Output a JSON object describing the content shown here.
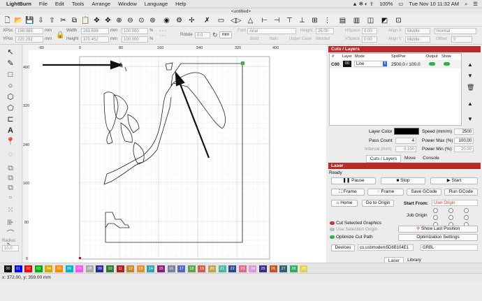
{
  "menubar": {
    "apple": "",
    "app": "LightBurn",
    "items": [
      "File",
      "Edit",
      "Tools",
      "Arrange",
      "Window",
      "Language",
      "Help"
    ],
    "battery": "100%",
    "clock": "Tue Nov 10  11:32 AM",
    "badge": "5"
  },
  "window": {
    "title": "<untitled>"
  },
  "props": {
    "xpos_label": "XPos",
    "xpos": "198.085",
    "ypos_label": "YPos",
    "ypos": "220.292",
    "width_label": "Width",
    "width": "283.598",
    "height_label": "Height",
    "height": "370.452",
    "unit": "mm",
    "wpct": "100.000",
    "hpct": "100.000",
    "pct": "%",
    "rotate_label": "Rotate",
    "rotate": "0.0",
    "mm_btn": "mm",
    "font_label": "Font",
    "font": "Arial",
    "theight_label": "Height",
    "theight": "25.00",
    "hspace_label": "HSpace",
    "hspace": "0.00",
    "aligny_label": "Align X",
    "alignx": "Middle",
    "normal": "Normal",
    "bold": "Bold",
    "italic": "Italic",
    "upper": "Upper Case",
    "welded": "Welded",
    "vspace_label": "VSpace",
    "vspace": "0.00",
    "aligny2_label": "Align Y",
    "aligny": "Middle",
    "offset_label": "Offset",
    "offset": "0"
  },
  "ruler": {
    "top": [
      "-80",
      "0",
      "80",
      "160",
      "240",
      "320",
      "400"
    ],
    "left": [
      "400",
      "320",
      "240",
      "160",
      "80",
      "0"
    ]
  },
  "lefttools": {
    "radius_label": "Radius:",
    "radius": "10.0"
  },
  "cuts": {
    "title": "Cuts / Layers",
    "cols": [
      "#",
      "Layer",
      "Mode",
      "Spd/Pwr",
      "Output",
      "Show"
    ],
    "row": {
      "num": "C00",
      "layer": "00",
      "mode": "Line",
      "spdpwr": "2500.0 / 100.0"
    },
    "layer_color_label": "Layer Color",
    "speed_label": "Speed (mm/m)",
    "speed": "2500",
    "pass_label": "Pass Count",
    "pass": "4",
    "pmax_label": "Power Max (%)",
    "pmax": "100.00",
    "interval_label": "Interval (mm)",
    "interval": "0.100",
    "pmin_label": "Power Min (%)",
    "pmin": "20.00",
    "tabs": [
      "Cuts / Layers",
      "Move",
      "Console"
    ]
  },
  "laser": {
    "title": "Laser",
    "status": "Ready",
    "pause": "Pause",
    "stop": "Stop",
    "start": "Start",
    "frame1": "Frame",
    "frame2": "Frame",
    "save_gcode": "Save GCode",
    "run_gcode": "Run GCode",
    "home": "Home",
    "goto_origin": "Go to Origin",
    "start_from_label": "Start From:",
    "start_from": "User Origin",
    "job_origin": "Job Origin",
    "cut_selected": "Cut Selected Graphics",
    "use_selection": "Use Selection Origin",
    "optimize": "Optimize Cut Path",
    "show_last": "Show Last Position",
    "opt_settings": "Optimization Settings",
    "devices": "Devices",
    "port": "cu.usbmodem5D8B104E1",
    "grbl": "GRBL",
    "tabs": [
      "Laser",
      "Library"
    ]
  },
  "palette": [
    {
      "n": "00",
      "c": "#000000"
    },
    {
      "n": "01",
      "c": "#0000ff"
    },
    {
      "n": "02",
      "c": "#ff0000"
    },
    {
      "n": "03",
      "c": "#00b000"
    },
    {
      "n": "04",
      "c": "#d6a800"
    },
    {
      "n": "05",
      "c": "#ff8c00"
    },
    {
      "n": "06",
      "c": "#00b4d8"
    },
    {
      "n": "07",
      "c": "#ff55ff"
    },
    {
      "n": "08",
      "c": "#a8a8a8"
    },
    {
      "n": "09",
      "c": "#2a2aa0"
    },
    {
      "n": "10",
      "c": "#2e7d32"
    },
    {
      "n": "11",
      "c": "#b71c1c"
    },
    {
      "n": "12",
      "c": "#c28a2c"
    },
    {
      "n": "13",
      "c": "#e0932c"
    },
    {
      "n": "14",
      "c": "#2ea3b4"
    },
    {
      "n": "15",
      "c": "#8b1f7a"
    },
    {
      "n": "16",
      "c": "#7e7e9e"
    },
    {
      "n": "17",
      "c": "#4a6cc2"
    },
    {
      "n": "18",
      "c": "#62a44a"
    },
    {
      "n": "19",
      "c": "#d55a4a"
    },
    {
      "n": "20",
      "c": "#c0a44c"
    },
    {
      "n": "21",
      "c": "#4ab8a8"
    },
    {
      "n": "22",
      "c": "#2b4c8c"
    },
    {
      "n": "23",
      "c": "#e06a8a"
    },
    {
      "n": "24",
      "c": "#d89ad8"
    },
    {
      "n": "25",
      "c": "#3a2a8a"
    },
    {
      "n": "26",
      "c": "#c2541e"
    },
    {
      "n": "27",
      "c": "#2e6070"
    },
    {
      "n": "28",
      "c": "#33aa66"
    },
    {
      "n": "29",
      "c": "#e0d450"
    }
  ],
  "status": {
    "coords": "x: 372.00, y: 359.00 mm"
  }
}
